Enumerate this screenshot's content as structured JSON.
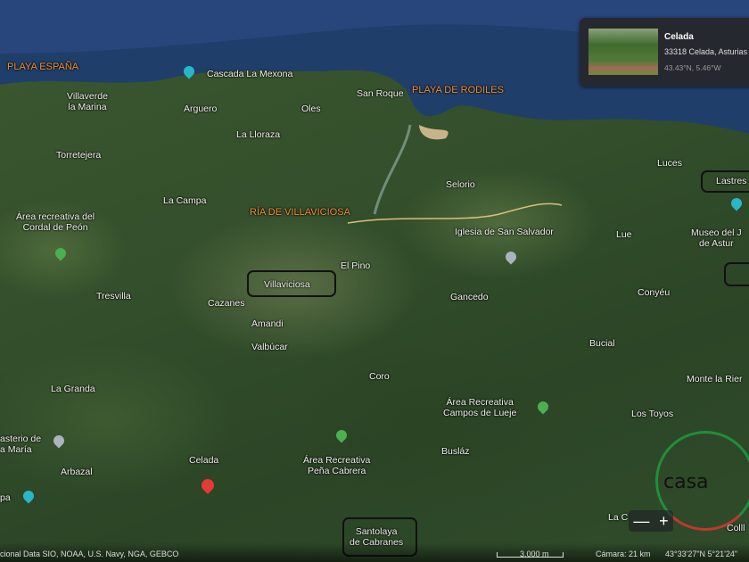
{
  "map": {
    "regions_orange": [
      "PLAYA ESPAÑA",
      "PLAYA DE RODILES",
      "RÍA DE VILLAVICIOSA"
    ],
    "places": [
      "Cascada La Mexona",
      "Villaverde\nla Marina",
      "Arguero",
      "Oles",
      "San Roque",
      "La Lloraza",
      "Torretejera",
      "La Campa",
      "Área recreativa del\nCordal de Peón",
      "Selorio",
      "Iglesia de San Salvador",
      "El Pino",
      "Villaviciosa",
      "Cazanes",
      "Amandi",
      "Valbúcar",
      "Tresvilla",
      "Gancedo",
      "Luces",
      "Lastres",
      "Museo del J\nde Astur",
      "Lue",
      "Conyéu",
      "Bucial",
      "Monte la Rier",
      "Coro",
      "Área Recreativa\nCampos de Lueje",
      "Los Toyos",
      "La Granda",
      "Busláz",
      "Área Recreativa\nPeña Cabrera",
      "Celada",
      "Santolaya\nde Cabranes",
      "asterio de\na María",
      "Arbazal",
      "pa",
      "La C",
      "Colll"
    ]
  },
  "place_card": {
    "title": "Celada",
    "address": "33318 Celada, Asturias",
    "coords": "43.43°N, 5.46°W"
  },
  "footer": {
    "attribution": "cional  Data SIO, NOAA, U.S. Navy, NGA, GEBCO",
    "scale": "3.000 m",
    "camera": "Cámara: 21 km",
    "coords": "43°33'27\"N 5°21'24\""
  },
  "controls": {
    "zoom_out": "—",
    "zoom_in": "+"
  },
  "logo": {
    "text": "casa"
  }
}
